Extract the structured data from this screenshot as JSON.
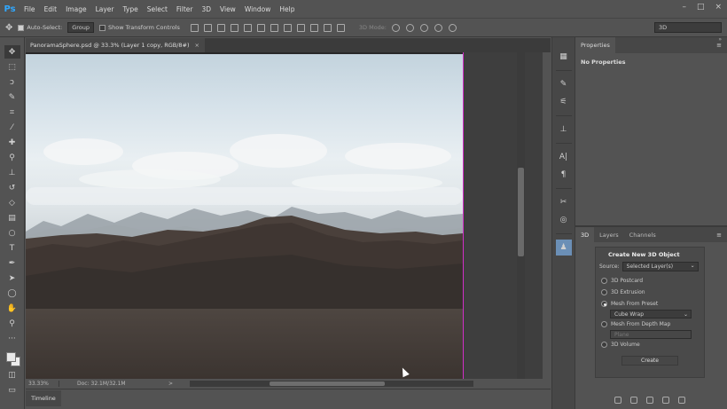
{
  "app": {
    "logo": "Ps",
    "menu": [
      "File",
      "Edit",
      "Image",
      "Layer",
      "Type",
      "Select",
      "Filter",
      "3D",
      "View",
      "Window",
      "Help"
    ],
    "window_controls": [
      "–",
      "□",
      "×"
    ]
  },
  "options_bar": {
    "auto_select_label": "Auto-Select:",
    "auto_select_checked": true,
    "auto_select_target": "Group",
    "show_transform_label": "Show Transform Controls",
    "show_transform_checked": false,
    "mode_3d_label": "3D Mode:",
    "workspace": "3D"
  },
  "document": {
    "tab_title": "PanoramaSphere.psd @ 33.3% (Layer 1 copy, RGB/8#)",
    "tab_close": "×"
  },
  "status_bar": {
    "zoom": "33.33%",
    "doc_size": "Doc: 32.1M/32.1M",
    "arrow": ">"
  },
  "timeline": {
    "tab_label": "Timeline"
  },
  "properties_panel": {
    "tab_label": "Properties",
    "menu_icon": "≡",
    "collapse": "»",
    "message": "No Properties"
  },
  "panel_3d": {
    "tabs": [
      "3D",
      "Layers",
      "Channels"
    ],
    "active_tab": "3D",
    "menu_icon": "≡",
    "create_title": "Create New 3D Object",
    "source_label": "Source:",
    "source_value": "Selected Layer(s)",
    "options": [
      {
        "label": "3D Postcard",
        "selected": false
      },
      {
        "label": "3D Extrusion",
        "selected": false
      },
      {
        "label": "Mesh From Preset",
        "selected": true
      },
      {
        "label": "Mesh From Depth Map",
        "selected": false
      },
      {
        "label": "3D Volume",
        "selected": false
      }
    ],
    "preset_value": "Cube Wrap",
    "depth_map_value": "Plane",
    "create_button": "Create"
  },
  "colors": {
    "accent_guide": "#d12ec8",
    "ps_blue": "#31a8ff",
    "ui_gray": "#535353"
  }
}
